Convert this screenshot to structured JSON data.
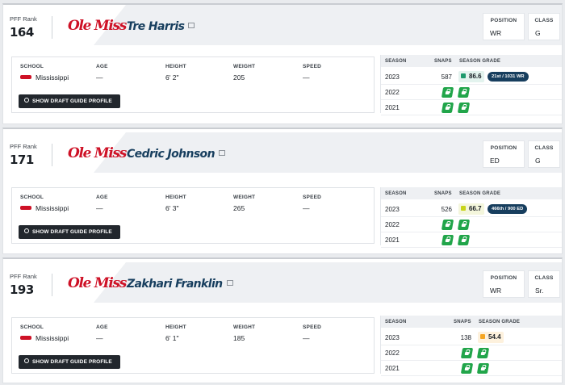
{
  "rank_label": "PFF Rank",
  "logo_text": "Ole Miss",
  "labels": {
    "position": "POSITION",
    "class": "CLASS",
    "school": "SCHOOL",
    "age": "AGE",
    "height": "HEIGHT",
    "weight": "WEIGHT",
    "speed": "SPEED",
    "season": "SEASON",
    "snaps": "SNAPS",
    "season_grade": "SEASON GRADE",
    "button": "SHOW DRAFT GUIDE PROFILE"
  },
  "colors": {
    "brand_red": "#ce1126",
    "navy": "#173e5e",
    "lock_green": "#21a54a",
    "grade_green": "#1d9a6c",
    "grade_yellow": "#c8d41a",
    "grade_orange": "#f5a623"
  },
  "players": [
    {
      "rank": "164",
      "name": "Tre Harris",
      "position": "WR",
      "class": "G",
      "school": "Mississippi",
      "age": "—",
      "height": "6' 2\"",
      "weight": "205",
      "speed": "—",
      "seasons": [
        {
          "year": "2023",
          "snaps": "587",
          "grade": "86.6",
          "grade_color": "#1d9a6c",
          "grade_bg": "#e3f3ee",
          "rank_badge": "21st / 1031 WR",
          "locked": false
        },
        {
          "year": "2022",
          "locked": true
        },
        {
          "year": "2021",
          "locked": true
        }
      ]
    },
    {
      "rank": "171",
      "name": "Cedric Johnson",
      "position": "ED",
      "class": "G",
      "school": "Mississippi",
      "age": "—",
      "height": "6' 3\"",
      "weight": "265",
      "speed": "—",
      "seasons": [
        {
          "year": "2023",
          "snaps": "526",
          "grade": "66.7",
          "grade_color": "#c8d41a",
          "grade_bg": "#f4f6dc",
          "rank_badge": "466th / 900 ED",
          "locked": false
        },
        {
          "year": "2022",
          "locked": true
        },
        {
          "year": "2021",
          "locked": true
        }
      ]
    },
    {
      "rank": "193",
      "name": "Zakhari Franklin",
      "position": "WR",
      "class": "Sr.",
      "school": "Mississippi",
      "age": "—",
      "height": "6' 1\"",
      "weight": "185",
      "speed": "—",
      "seasons": [
        {
          "year": "2023",
          "snaps": "138",
          "grade": "54.4",
          "grade_color": "#f5a623",
          "grade_bg": "#fdf1dd",
          "rank_badge": "",
          "locked": false
        },
        {
          "year": "2022",
          "locked": true
        },
        {
          "year": "2021",
          "locked": true
        }
      ]
    }
  ]
}
